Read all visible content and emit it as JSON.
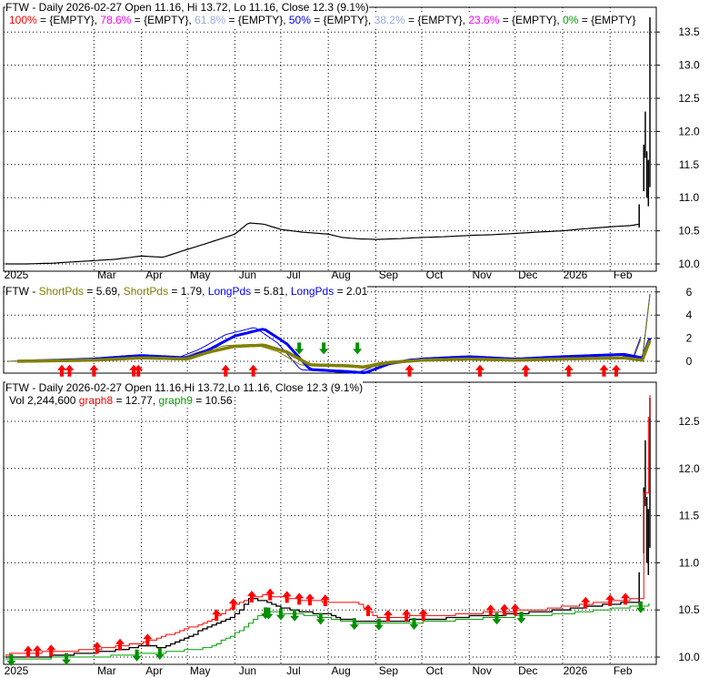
{
  "panel1": {
    "title": "FTW - Daily 2026-02-27 Open 11.16, Hi 13.72, Lo 11.16, Close 12.3 (9.1%)",
    "fib": [
      {
        "label": "100%",
        "value": " = {EMPTY}, ",
        "color": "#ff0000"
      },
      {
        "label": "78.6%",
        "value": " = {EMPTY}, ",
        "color": "#ff00ff"
      },
      {
        "label": "61.8%",
        "value": " = {EMPTY}, ",
        "color": "#99aadd"
      },
      {
        "label": "50%",
        "value": " = {EMPTY}, ",
        "color": "#0000ff"
      },
      {
        "label": "38.2%",
        "value": " = {EMPTY}, ",
        "color": "#99aadd"
      },
      {
        "label": "23.6%",
        "value": " = {EMPTY}, ",
        "color": "#ff00ff"
      },
      {
        "label": "0%",
        "value": " = {EMPTY}",
        "color": "#00a000"
      }
    ]
  },
  "panel2": {
    "prefix": "FTW - ",
    "items": [
      {
        "label": "ShortPds",
        "value": " = 5.69, ",
        "color": "#808000"
      },
      {
        "label": "ShortPds",
        "value": " = 1.79, ",
        "color": "#808000"
      },
      {
        "label": "LongPds",
        "value": " = 5.81, ",
        "color": "#0000ff"
      },
      {
        "label": "LongPds",
        "value": " = 2.01",
        "color": "#0000ff"
      }
    ]
  },
  "panel3": {
    "title": "FTW - Daily 2026-02-27 Open 11.16,Hi 13.72,Lo 11.16, Close 12.3 (9.1%)",
    "vol": "Vol 2,244,600",
    "g8_label": "graph8",
    "g8_value": " = 12.77",
    "g9_label": "graph9",
    "g9_value": " = 10.56"
  },
  "chart_data": {
    "type": "line",
    "ticker": "FTW",
    "date_range": [
      "2025-01-01",
      "2026-02-27"
    ],
    "month_labels": [
      [
        "2025",
        "2025-01-01"
      ],
      [
        "Mar",
        "2025-03-01"
      ],
      [
        "Apr",
        "2025-04-01"
      ],
      [
        "May",
        "2025-05-01"
      ],
      [
        "Jun",
        "2025-06-01"
      ],
      [
        "Jul",
        "2025-07-01"
      ],
      [
        "Aug",
        "2025-08-01"
      ],
      [
        "Sep",
        "2025-09-01"
      ],
      [
        "Oct",
        "2025-10-01"
      ],
      [
        "Nov",
        "2025-11-01"
      ],
      [
        "Dec",
        "2025-12-01"
      ],
      [
        "2026",
        "2026-01-01"
      ],
      [
        "Feb",
        "2026-02-01"
      ]
    ],
    "price_axis1": [
      10.0,
      10.5,
      11.0,
      11.5,
      12.0,
      12.5,
      13.0,
      13.5
    ],
    "price_axis3": [
      10.0,
      10.5,
      11.0,
      11.5,
      12.0,
      12.5
    ],
    "osc_axis": [
      0,
      2,
      4,
      6
    ],
    "close": [
      [
        "2025-01-02",
        10.0
      ],
      [
        "2025-01-15",
        10.0
      ],
      [
        "2025-02-01",
        10.01
      ],
      [
        "2025-02-15",
        10.03
      ],
      [
        "2025-03-01",
        10.05
      ],
      [
        "2025-03-15",
        10.07
      ],
      [
        "2025-04-01",
        10.12
      ],
      [
        "2025-04-15",
        10.1
      ],
      [
        "2025-05-01",
        10.22
      ],
      [
        "2025-05-15",
        10.32
      ],
      [
        "2025-06-01",
        10.45
      ],
      [
        "2025-06-10",
        10.62
      ],
      [
        "2025-06-20",
        10.6
      ],
      [
        "2025-07-01",
        10.52
      ],
      [
        "2025-07-15",
        10.48
      ],
      [
        "2025-08-01",
        10.45
      ],
      [
        "2025-08-10",
        10.4
      ],
      [
        "2025-08-20",
        10.38
      ],
      [
        "2025-09-01",
        10.37
      ],
      [
        "2025-09-15",
        10.38
      ],
      [
        "2025-10-01",
        10.4
      ],
      [
        "2025-10-15",
        10.41
      ],
      [
        "2025-11-01",
        10.43
      ],
      [
        "2025-11-15",
        10.44
      ],
      [
        "2025-12-01",
        10.46
      ],
      [
        "2025-12-15",
        10.48
      ],
      [
        "2026-01-01",
        10.5
      ],
      [
        "2026-01-15",
        10.53
      ],
      [
        "2026-02-01",
        10.56
      ],
      [
        "2026-02-15",
        10.58
      ],
      [
        "2026-02-20",
        10.6
      ],
      [
        "2026-02-23",
        11.5
      ],
      [
        "2026-02-24",
        12.0
      ],
      [
        "2026-02-25",
        11.4
      ],
      [
        "2026-02-26",
        11.27
      ],
      [
        "2026-02-27",
        12.3
      ]
    ],
    "last_bar": {
      "open": 11.16,
      "high": 13.72,
      "low": 11.16,
      "close": 12.3
    },
    "graph8": [
      [
        "2025-01-02",
        10.03
      ],
      [
        "2025-03-01",
        10.08
      ],
      [
        "2025-04-01",
        10.15
      ],
      [
        "2025-05-15",
        10.38
      ],
      [
        "2025-06-05",
        10.6
      ],
      [
        "2025-06-20",
        10.66
      ],
      [
        "2025-07-15",
        10.6
      ],
      [
        "2025-08-20",
        10.57
      ],
      [
        "2025-09-01",
        10.42
      ],
      [
        "2025-10-15",
        10.44
      ],
      [
        "2025-11-15",
        10.48
      ],
      [
        "2025-12-15",
        10.5
      ],
      [
        "2026-01-15",
        10.56
      ],
      [
        "2026-02-20",
        10.62
      ],
      [
        "2026-02-24",
        12.1
      ],
      [
        "2026-02-27",
        12.77
      ]
    ],
    "graph9": [
      [
        "2025-01-02",
        9.98
      ],
      [
        "2025-03-01",
        10.0
      ],
      [
        "2025-04-15",
        10.05
      ],
      [
        "2025-05-15",
        10.1
      ],
      [
        "2025-06-01",
        10.25
      ],
      [
        "2025-06-20",
        10.48
      ],
      [
        "2025-07-15",
        10.45
      ],
      [
        "2025-08-20",
        10.36
      ],
      [
        "2025-09-15",
        10.36
      ],
      [
        "2025-10-15",
        10.38
      ],
      [
        "2025-11-15",
        10.42
      ],
      [
        "2025-12-15",
        10.44
      ],
      [
        "2026-01-15",
        10.48
      ],
      [
        "2026-02-20",
        10.54
      ],
      [
        "2026-02-27",
        10.56
      ]
    ],
    "short": [
      [
        "2025-01-10",
        0
      ],
      [
        "2025-03-01",
        0.1
      ],
      [
        "2025-04-01",
        0.3
      ],
      [
        "2025-05-01",
        0.2
      ],
      [
        "2025-05-15",
        0.8
      ],
      [
        "2025-06-01",
        1.3
      ],
      [
        "2025-06-20",
        1.4
      ],
      [
        "2025-07-05",
        0.8
      ],
      [
        "2025-07-20",
        -0.3
      ],
      [
        "2025-08-15",
        -0.4
      ],
      [
        "2025-08-25",
        -0.5
      ],
      [
        "2025-09-10",
        -0.1
      ],
      [
        "2025-10-01",
        0.1
      ],
      [
        "2025-11-01",
        0.2
      ],
      [
        "2025-12-01",
        0.1
      ],
      [
        "2026-01-01",
        0.2
      ],
      [
        "2026-02-10",
        0.3
      ],
      [
        "2026-02-22",
        0.1
      ],
      [
        "2026-02-27",
        1.79
      ]
    ],
    "long": [
      [
        "2025-01-10",
        0
      ],
      [
        "2025-03-01",
        0.2
      ],
      [
        "2025-04-01",
        0.5
      ],
      [
        "2025-05-01",
        0.3
      ],
      [
        "2025-05-15",
        1.0
      ],
      [
        "2025-06-01",
        2.2
      ],
      [
        "2025-06-20",
        2.8
      ],
      [
        "2025-07-05",
        1.5
      ],
      [
        "2025-07-20",
        -0.7
      ],
      [
        "2025-08-15",
        -0.9
      ],
      [
        "2025-08-25",
        -1.0
      ],
      [
        "2025-09-10",
        -0.2
      ],
      [
        "2025-10-01",
        0.2
      ],
      [
        "2025-11-01",
        0.4
      ],
      [
        "2025-12-01",
        0.2
      ],
      [
        "2026-01-01",
        0.4
      ],
      [
        "2026-02-10",
        0.6
      ],
      [
        "2026-02-22",
        0.3
      ],
      [
        "2026-02-27",
        2.01
      ]
    ],
    "arrows2_down": [
      "2025-02-08",
      "2025-02-13",
      "2025-03-01",
      "2025-03-27",
      "2025-03-30",
      "2025-05-26",
      "2025-06-13",
      "2025-09-23",
      "2025-11-08",
      "2025-12-08",
      "2026-01-05",
      "2026-01-28",
      "2026-02-05"
    ],
    "arrows2_up": [
      "2025-07-13",
      "2025-07-29",
      "2025-08-20"
    ],
    "arrows3_down": [
      "2025-01-17",
      "2025-01-23",
      "2025-02-01",
      "2025-03-03",
      "2025-03-18",
      "2025-04-05",
      "2025-05-20",
      "2025-05-31",
      "2025-06-12",
      "2025-06-24",
      "2025-07-05",
      "2025-07-13",
      "2025-07-20",
      "2025-07-30",
      "2025-08-27",
      "2025-09-09",
      "2025-09-21",
      "2025-10-02",
      "2025-11-15",
      "2025-11-24",
      "2025-12-01",
      "2026-01-16",
      "2026-02-01",
      "2026-02-11"
    ],
    "arrows3_up": [
      "2025-01-06",
      "2025-02-11",
      "2025-03-29",
      "2025-04-13",
      "2025-06-21",
      "2025-06-23",
      "2025-07-01",
      "2025-07-10",
      "2025-07-27",
      "2025-08-18",
      "2025-09-03",
      "2025-09-26",
      "2025-11-19",
      "2025-12-05",
      "2026-02-21"
    ]
  }
}
